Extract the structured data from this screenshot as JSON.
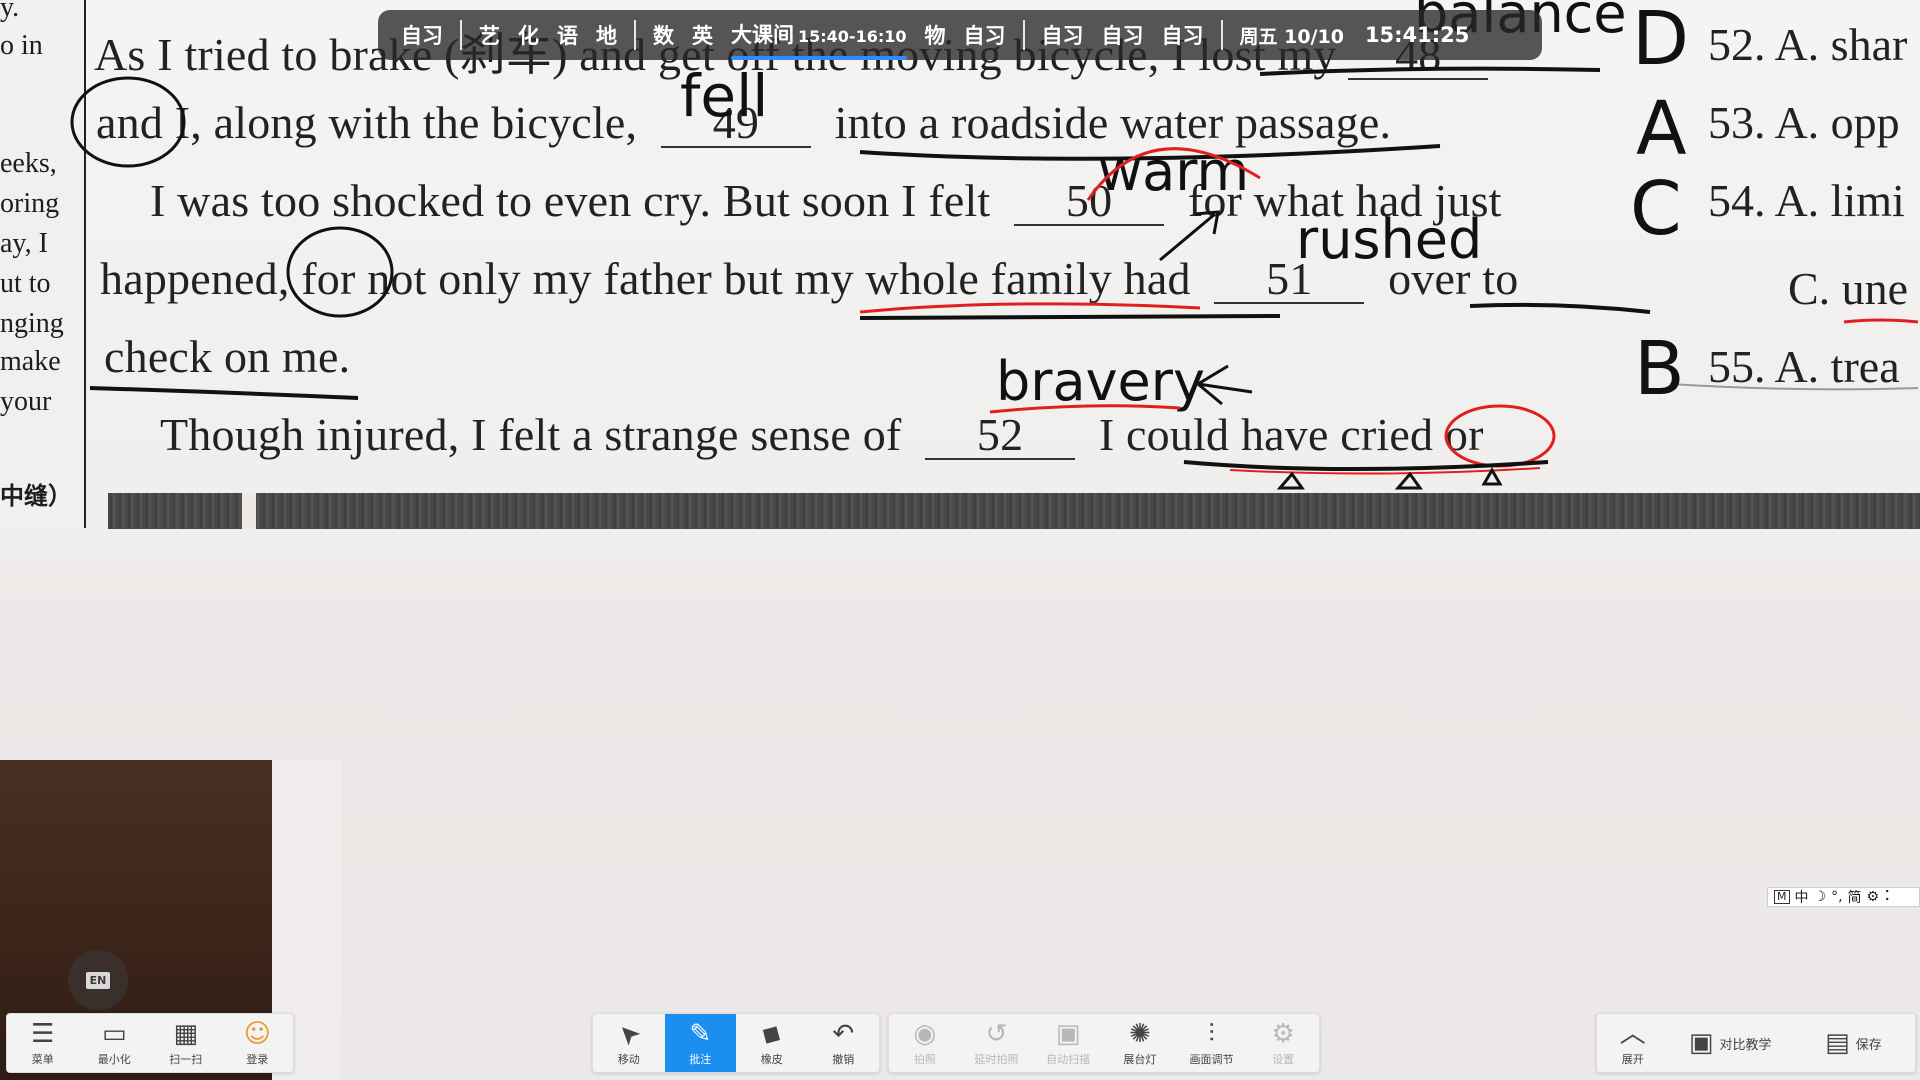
{
  "schedule": {
    "items": [
      "自习",
      "艺",
      "化",
      "语",
      "地",
      "数",
      "英",
      "物",
      "自习",
      "自习",
      "自习",
      "自习"
    ],
    "current_label": "大课间",
    "current_time": "15:40-16:10",
    "date": "周五 10/10",
    "clock": "15:41:25"
  },
  "document": {
    "left_column": [
      "y.",
      "o in",
      "eeks,",
      "oring",
      "ay, I",
      "ut to",
      "nging",
      "make",
      "your",
      "中缝）"
    ],
    "line1": "As I tried to brake (刹车) and get off the moving bicycle, I lost my",
    "blank48": "48",
    "line2_start": "and I, along with the bicycle,",
    "blank49": "49",
    "line2_end": "into a roadside water passage.",
    "line3_start": "I was too shocked to even cry. But soon I felt",
    "blank50": "50",
    "line3_end": "for what had just",
    "line4_start": "happened, for not only my father but my whole family had",
    "blank51": "51",
    "line4_end": "over to",
    "line5": "check on me.",
    "line6_start": "Though injured, I felt a strange sense of",
    "blank52": "52",
    "line6_end": "I could have cried or",
    "handwriting": {
      "balance": "balance",
      "fell": "fell",
      "warm": "warm",
      "rushed": "rushed",
      "bravery": "bravery"
    },
    "answers": [
      "D",
      "A",
      "C",
      "B"
    ],
    "options": [
      "52. A. shar",
      "53. A. opp",
      "54. A. limi",
      "C. une",
      "55. A. trea"
    ]
  },
  "ime": {
    "m": "M",
    "lang": "中",
    "moon": "☽",
    "punct": "°,",
    "simplified": "简",
    "gear": "⚙",
    "more": "⠅"
  },
  "en_badge": "EN",
  "toolbar_left": [
    {
      "icon": "☰",
      "label": "菜单"
    },
    {
      "icon": "▭",
      "label": "最小化"
    },
    {
      "icon": "▦",
      "label": "扫一扫"
    },
    {
      "icon": "☺",
      "label": "登录"
    }
  ],
  "toolbar_mid": [
    {
      "icon": "➤",
      "label": "移动"
    },
    {
      "icon": "✎",
      "label": "批注"
    },
    {
      "icon": "◆",
      "label": "橡皮"
    },
    {
      "icon": "↶",
      "label": "撤销"
    }
  ],
  "toolbar_cam": [
    {
      "icon": "◉",
      "label": "拍照"
    },
    {
      "icon": "↺",
      "label": "延时拍照"
    },
    {
      "icon": "▣",
      "label": "自动扫描"
    },
    {
      "icon": "✺",
      "label": "展台灯"
    },
    {
      "icon": "⫶",
      "label": "画面调节"
    },
    {
      "icon": "⚙",
      "label": "设置"
    }
  ],
  "toolbar_right": [
    {
      "icon": "︿",
      "label": "展开"
    },
    {
      "icon": "▣",
      "label": "对比教学"
    },
    {
      "icon": "▤",
      "label": "保存"
    }
  ],
  "colors": {
    "accent": "#1d8ef1",
    "annotation_red": "#e02020",
    "schedule_bg": "#282828"
  }
}
